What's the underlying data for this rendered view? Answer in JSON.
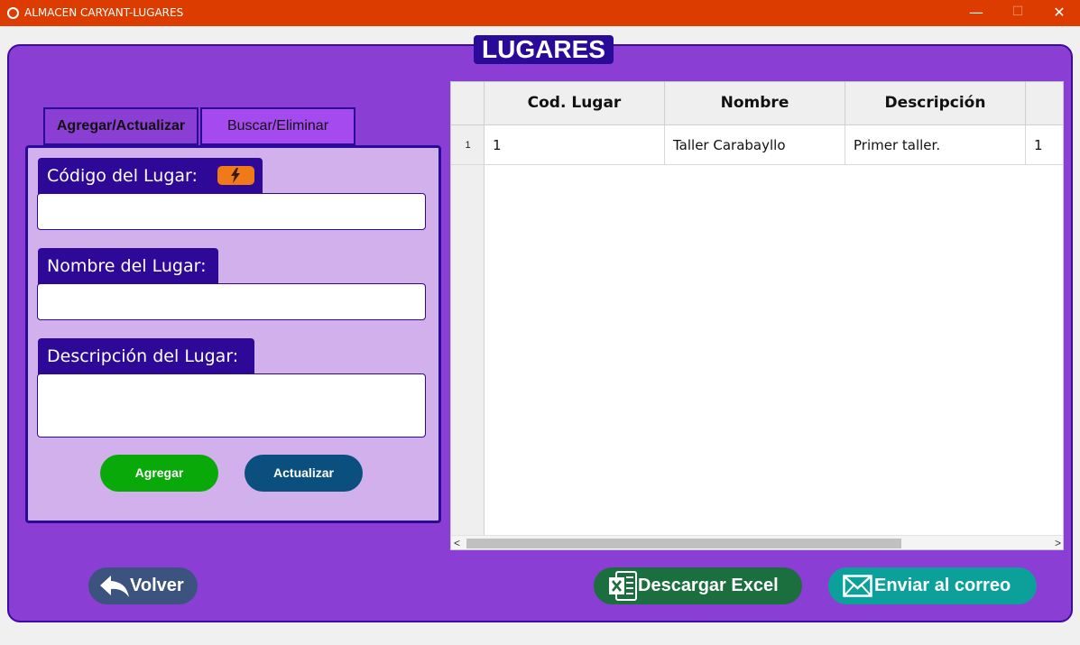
{
  "window": {
    "title": "ALMACEN CARYANT-LUGARES",
    "minimize_glyph": "—",
    "maximize_glyph": "☐",
    "close_glyph": "✕",
    "accent_color": "#dd3c00"
  },
  "page": {
    "title": "LUGARES",
    "panel_color": "#8b3ed4"
  },
  "tabs": [
    {
      "label": "Agregar/Actualizar",
      "active": true
    },
    {
      "label": "Buscar/Eliminar",
      "active": false
    }
  ],
  "form": {
    "codigo_label": "Código del Lugar:",
    "codigo_value": "",
    "generate_icon": "lightning-icon",
    "nombre_label": "Nombre del Lugar:",
    "nombre_value": "",
    "descripcion_label": "Descripción del Lugar:",
    "descripcion_value": "",
    "agregar_label": "Agregar",
    "actualizar_label": "Actualizar"
  },
  "table": {
    "columns": [
      "Cod. Lugar",
      "Nombre",
      "Descripción",
      ""
    ],
    "rows": [
      {
        "num": "1",
        "cells": [
          "1",
          "Taller Carabayllo",
          "Primer taller.",
          "1"
        ]
      }
    ],
    "scroll_left": "<",
    "scroll_right": ">"
  },
  "actions": {
    "volver_label": "Volver",
    "volver_icon": "back-arrow-icon",
    "excel_label": "Descargar Excel",
    "excel_icon": "excel-icon",
    "correo_label": "Enviar al correo",
    "correo_icon": "mail-icon"
  }
}
